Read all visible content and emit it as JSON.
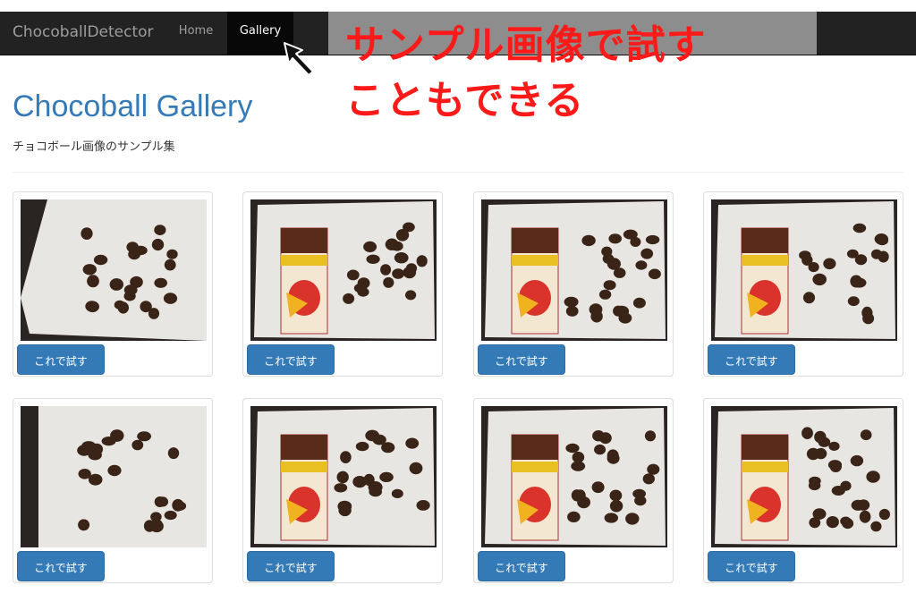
{
  "navbar": {
    "brand": "ChocoballDetector",
    "links": [
      {
        "label": "Home",
        "active": false
      },
      {
        "label": "Gallery",
        "active": true
      }
    ]
  },
  "annotation": {
    "line1": "サンプル画像で試す",
    "line2": "こともできる",
    "color": "#ff1a1a"
  },
  "page": {
    "title": "Chocoball Gallery",
    "subtitle": "チョコボール画像のサンプル集"
  },
  "gallery": {
    "items": [
      {
        "button_label": "これで試す",
        "has_box": false
      },
      {
        "button_label": "これで試す",
        "has_box": true
      },
      {
        "button_label": "これで試す",
        "has_box": true
      },
      {
        "button_label": "これで試す",
        "has_box": true
      },
      {
        "button_label": "これで試す",
        "has_box": false
      },
      {
        "button_label": "これで試す",
        "has_box": true
      },
      {
        "button_label": "これで試す",
        "has_box": true
      },
      {
        "button_label": "これで試す",
        "has_box": true
      }
    ]
  },
  "colors": {
    "navbar_bg": "#222222",
    "link_color": "#337ab7",
    "button_bg": "#337ab7",
    "chocoball": "#3a2418"
  }
}
